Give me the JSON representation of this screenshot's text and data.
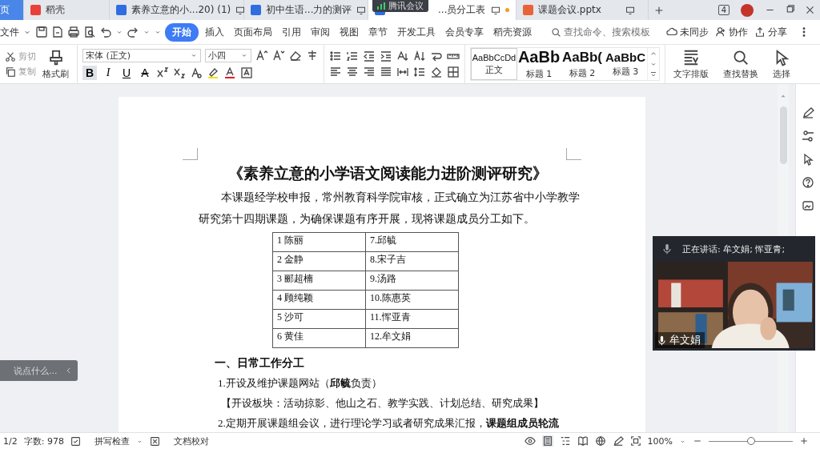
{
  "tabs": [
    {
      "label": "页",
      "kind": "home",
      "selected": false
    },
    {
      "label": "稻壳",
      "kind": "docer",
      "selected": false
    },
    {
      "label": "素养立意的小...20) (1)",
      "kind": "word",
      "selected": false
    },
    {
      "label": "初中生语...力的测评",
      "kind": "word",
      "selected": false
    },
    {
      "label": "...员分工表",
      "kind": "word",
      "selected": true
    },
    {
      "label": "课题会议.pptx",
      "kind": "ppt",
      "selected": false
    }
  ],
  "window_count": "4",
  "meeting_indicator": "腾讯会议",
  "menu": {
    "file": "文件",
    "items": [
      {
        "label": "开始",
        "selected": true
      },
      {
        "label": "插入",
        "selected": false
      },
      {
        "label": "页面布局",
        "selected": false
      },
      {
        "label": "引用",
        "selected": false
      },
      {
        "label": "审阅",
        "selected": false
      },
      {
        "label": "视图",
        "selected": false
      },
      {
        "label": "章节",
        "selected": false
      },
      {
        "label": "开发工具",
        "selected": false
      },
      {
        "label": "会员专享",
        "selected": false
      },
      {
        "label": "稻壳资源",
        "selected": false
      }
    ],
    "search": {
      "placeholder": "查找命令、搜索模板"
    },
    "actions": [
      "未同步",
      "协作",
      "分享"
    ]
  },
  "ribbon": {
    "cut": "剪切",
    "copy": "复制",
    "format_painter": "格式刷",
    "font": "宋体 (正文)",
    "font_size": "小四",
    "format_keys": [
      {
        "label": "B",
        "kind": "bold",
        "selected": true
      },
      {
        "label": "I",
        "kind": "italic",
        "selected": false
      },
      {
        "label": "U",
        "kind": "underline",
        "selected": false
      },
      {
        "label": "A",
        "kind": "strike",
        "selected": false
      }
    ],
    "styles": [
      {
        "sample": "AaBbCcDd",
        "label": "正文",
        "kind": "body"
      },
      {
        "sample": "AaBb",
        "label": "标题 1",
        "kind": "h1"
      },
      {
        "sample": "AaBb(",
        "label": "标题 2",
        "kind": "h2"
      },
      {
        "sample": "AaBbC",
        "label": "标题 3",
        "kind": "h3"
      }
    ],
    "tools": [
      "文字排版",
      "查找替换",
      "选择"
    ]
  },
  "document": {
    "title": "《素养立意的小学语文阅读能力进阶测评研究》",
    "intro": "本课题经学校申报，常州教育科学院审核，正式确立为江苏省中小学教学研究第十四期课题，为确保课题有序开展，现将课题成员分工如下。",
    "table": {
      "rows": [
        [
          "1 陈丽",
          "7.邱毓"
        ],
        [
          "2 金静",
          "8.宋子吉"
        ],
        [
          "3 郦超楠",
          "9.汤路"
        ],
        [
          "4 顾纯颖",
          "10.陈惠英"
        ],
        [
          "5 沙可",
          "11.恽亚青"
        ],
        [
          "6 黄佳",
          "12.牟文娟"
        ]
      ]
    },
    "heading": "一、日常工作分工",
    "paragraphs": [
      {
        "text": "1.开设及维护课题网站（**邱毓**负责）",
        "kind": "item"
      },
      {
        "text": "【开设板块：活动掠影、他山之石、教学实践、计划总结、研究成果】",
        "kind": "note"
      },
      {
        "text": "2.定期开展课题组会议，进行理论学习或者研究成果汇报，**课题组成员轮流**",
        "kind": "item"
      }
    ]
  },
  "chat_box": {
    "placeholder": "说点什么..."
  },
  "video": {
    "speaking": "正在讲话: 牟文娟; 恽亚青;",
    "participant": "牟文娟"
  },
  "status_bar": {
    "page": "1/2",
    "word_count": "字数: 978",
    "spell_check": "拼写检查",
    "proofread": "文档校对",
    "zoom": "100%",
    "zoom_slider": {
      "level": 0.5
    }
  }
}
